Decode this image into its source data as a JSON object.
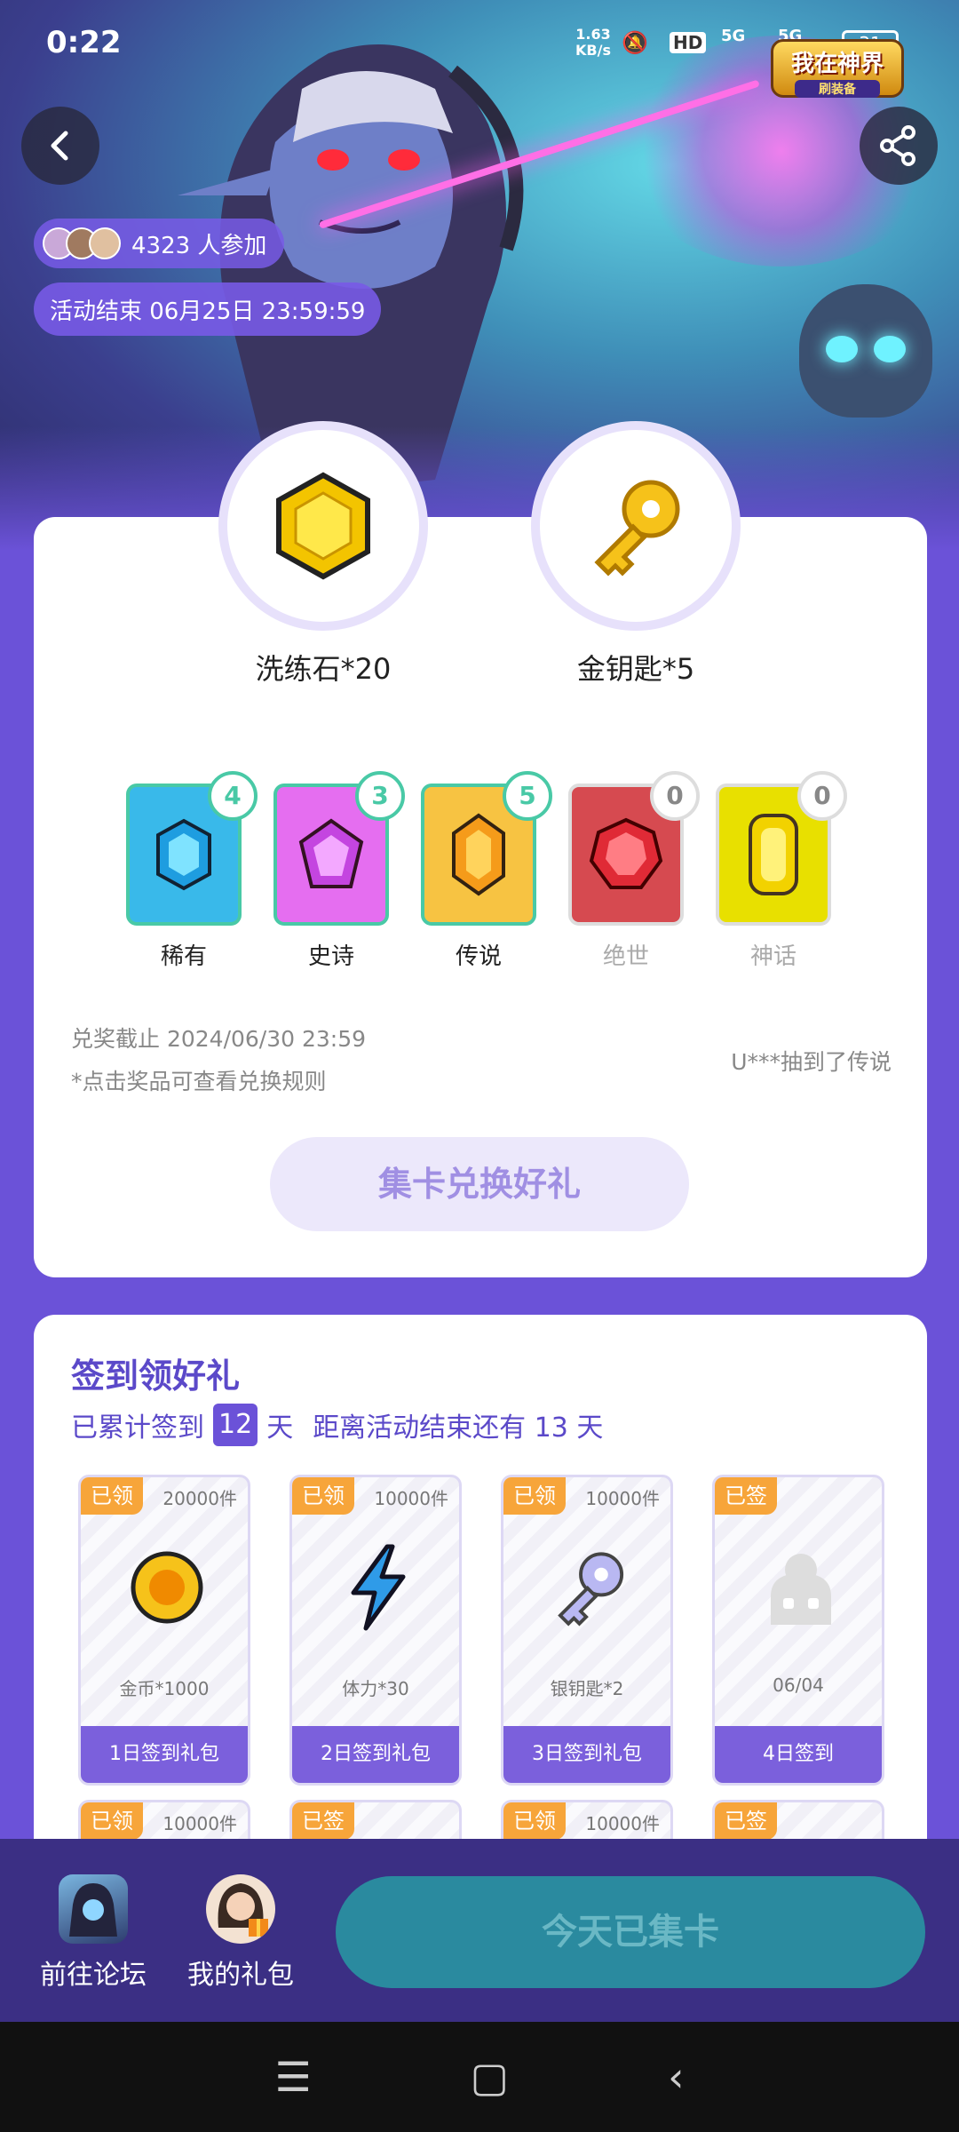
{
  "status": {
    "time": "0:22",
    "net_speed": "1.63",
    "net_unit": "KB/s",
    "hd": "HD",
    "sig1": "5G",
    "sig2": "5G",
    "battery": "31"
  },
  "logo": {
    "title": "我在神界",
    "subtitle": "刷装备"
  },
  "event": {
    "participants": "4323 人参加",
    "end_time": "活动结束 06月25日 23:59:59"
  },
  "prizes": [
    {
      "name": "洗练石*20",
      "icon": "hexagon-gem-icon"
    },
    {
      "name": "金钥匙*5",
      "icon": "gold-key-icon"
    }
  ],
  "cards": [
    {
      "label": "稀有",
      "count": "4",
      "color": "#39b9ea",
      "owned": true
    },
    {
      "label": "史诗",
      "count": "3",
      "color": "#e56ef0",
      "owned": true
    },
    {
      "label": "传说",
      "count": "5",
      "color": "#f7c342",
      "owned": true
    },
    {
      "label": "绝世",
      "count": "0",
      "color": "#d64a50",
      "owned": false
    },
    {
      "label": "神话",
      "count": "0",
      "color": "#e8e000",
      "owned": false
    }
  ],
  "redeem": {
    "deadline": "兑奖截止 2024/06/30 23:59",
    "rule": "*点击奖品可查看兑换规则",
    "winner": "U***抽到了传说",
    "button": "集卡兑换好礼"
  },
  "signin": {
    "title": "签到领好礼",
    "prefix": "已累计签到",
    "days": "12",
    "suffix": "天",
    "remaining": "距离活动结束还有 13 天",
    "rewards": [
      {
        "tag": "已领",
        "qty": "20000件",
        "name": "金币*1000",
        "footer": "1日签到礼包",
        "icon": "coin-icon"
      },
      {
        "tag": "已领",
        "qty": "10000件",
        "name": "体力*30",
        "footer": "2日签到礼包",
        "icon": "lightning-icon"
      },
      {
        "tag": "已领",
        "qty": "10000件",
        "name": "银钥匙*2",
        "footer": "3日签到礼包",
        "icon": "silver-key-icon"
      },
      {
        "tag": "已签",
        "qty": "",
        "name": "06/04",
        "footer": "4日签到",
        "icon": "mascot-icon"
      }
    ],
    "next_row": [
      {
        "tag": "已领",
        "qty": "10000件"
      },
      {
        "tag": "已签",
        "qty": ""
      },
      {
        "tag": "已领",
        "qty": "10000件"
      },
      {
        "tag": "已签",
        "qty": ""
      }
    ]
  },
  "bottom": {
    "forum": "前往论坛",
    "gifts": "我的礼包",
    "today": "今天已集卡"
  },
  "colors": {
    "background": "#6b52d8",
    "accent": "#5b49c9",
    "tag": "#f7a53a",
    "badge": "#49c9a6"
  }
}
